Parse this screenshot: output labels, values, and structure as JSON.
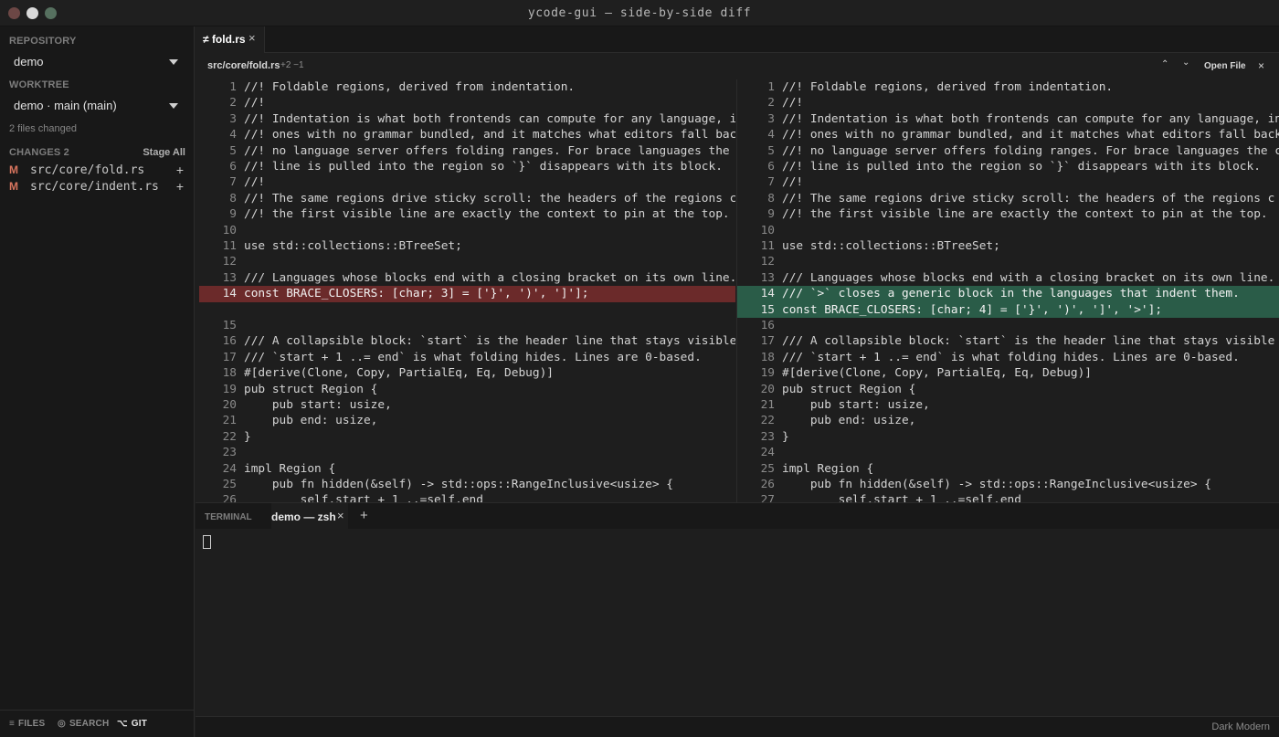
{
  "window": {
    "title": "ycode-gui — side-by-side diff"
  },
  "sidebar": {
    "repository_label": "REPOSITORY",
    "repository_value": "demo",
    "worktree_label": "WORKTREE",
    "worktree_value": "demo · main (main)",
    "files_changed": "2 files changed",
    "changes_label": "CHANGES 2",
    "stage_all": "Stage All",
    "changes": [
      {
        "status": "M",
        "path": "src/core/fold.rs",
        "action": "+"
      },
      {
        "status": "M",
        "path": "src/core/indent.rs",
        "action": "+"
      }
    ],
    "footer": [
      {
        "icon": "≡",
        "icon_name": "files-icon",
        "label": "FILES"
      },
      {
        "icon": "◎",
        "icon_name": "search-icon",
        "label": "SEARCH"
      },
      {
        "icon": "⌥",
        "icon_name": "git-branch-icon",
        "label": "GIT"
      }
    ]
  },
  "editor": {
    "tab": {
      "icon": "≠",
      "label": "fold.rs",
      "close": "×"
    },
    "diff_header": {
      "path": "src/core/fold.rs",
      "stats": "+2 −1",
      "prev": "⌃",
      "next": "⌄",
      "open_file": "Open File",
      "close": "×"
    },
    "left_lines": [
      {
        "n": "1",
        "t": "//! Foldable regions, derived from indentation.",
        "k": ""
      },
      {
        "n": "2",
        "t": "//!",
        "k": ""
      },
      {
        "n": "3",
        "t": "//! Indentation is what both frontends can compute for any language, in",
        "k": ""
      },
      {
        "n": "4",
        "t": "//! ones with no grammar bundled, and it matches what editors fall back",
        "k": ""
      },
      {
        "n": "5",
        "t": "//! no language server offers folding ranges. For brace languages the c",
        "k": ""
      },
      {
        "n": "6",
        "t": "//! line is pulled into the region so `}` disappears with its block.",
        "k": ""
      },
      {
        "n": "7",
        "t": "//!",
        "k": ""
      },
      {
        "n": "8",
        "t": "//! The same regions drive sticky scroll: the headers of the regions c",
        "k": ""
      },
      {
        "n": "9",
        "t": "//! the first visible line are exactly the context to pin at the top.",
        "k": ""
      },
      {
        "n": "10",
        "t": "",
        "k": ""
      },
      {
        "n": "11",
        "t": "use std::collections::BTreeSet;",
        "k": ""
      },
      {
        "n": "12",
        "t": "",
        "k": ""
      },
      {
        "n": "13",
        "t": "/// Languages whose blocks end with a closing bracket on its own line.",
        "k": ""
      },
      {
        "n": "14",
        "t": "const BRACE_CLOSERS: [char; 3] = ['}', ')', ']'];",
        "k": "del"
      },
      {
        "n": "",
        "t": "",
        "k": "filler"
      },
      {
        "n": "15",
        "t": "",
        "k": ""
      },
      {
        "n": "16",
        "t": "/// A collapsible block: `start` is the header line that stays visible",
        "k": ""
      },
      {
        "n": "17",
        "t": "/// `start + 1 ..= end` is what folding hides. Lines are 0-based.",
        "k": ""
      },
      {
        "n": "18",
        "t": "#[derive(Clone, Copy, PartialEq, Eq, Debug)]",
        "k": ""
      },
      {
        "n": "19",
        "t": "pub struct Region {",
        "k": ""
      },
      {
        "n": "20",
        "t": "    pub start: usize,",
        "k": ""
      },
      {
        "n": "21",
        "t": "    pub end: usize,",
        "k": ""
      },
      {
        "n": "22",
        "t": "}",
        "k": ""
      },
      {
        "n": "23",
        "t": "",
        "k": ""
      },
      {
        "n": "24",
        "t": "impl Region {",
        "k": ""
      },
      {
        "n": "25",
        "t": "    pub fn hidden(&self) -> std::ops::RangeInclusive<usize> {",
        "k": ""
      },
      {
        "n": "26",
        "t": "        self.start + 1 ..=self.end",
        "k": ""
      }
    ],
    "right_lines": [
      {
        "n": "1",
        "t": "//! Foldable regions, derived from indentation.",
        "k": ""
      },
      {
        "n": "2",
        "t": "//!",
        "k": ""
      },
      {
        "n": "3",
        "t": "//! Indentation is what both frontends can compute for any language, in",
        "k": ""
      },
      {
        "n": "4",
        "t": "//! ones with no grammar bundled, and it matches what editors fall back",
        "k": ""
      },
      {
        "n": "5",
        "t": "//! no language server offers folding ranges. For brace languages the c",
        "k": ""
      },
      {
        "n": "6",
        "t": "//! line is pulled into the region so `}` disappears with its block.",
        "k": ""
      },
      {
        "n": "7",
        "t": "//!",
        "k": ""
      },
      {
        "n": "8",
        "t": "//! The same regions drive sticky scroll: the headers of the regions c",
        "k": ""
      },
      {
        "n": "9",
        "t": "//! the first visible line are exactly the context to pin at the top.",
        "k": ""
      },
      {
        "n": "10",
        "t": "",
        "k": ""
      },
      {
        "n": "11",
        "t": "use std::collections::BTreeSet;",
        "k": ""
      },
      {
        "n": "12",
        "t": "",
        "k": ""
      },
      {
        "n": "13",
        "t": "/// Languages whose blocks end with a closing bracket on its own line.",
        "k": ""
      },
      {
        "n": "14",
        "t": "/// `>` closes a generic block in the languages that indent them.",
        "k": "add"
      },
      {
        "n": "15",
        "t": "const BRACE_CLOSERS: [char; 4] = ['}', ')', ']', '>'];",
        "k": "add"
      },
      {
        "n": "16",
        "t": "",
        "k": ""
      },
      {
        "n": "17",
        "t": "/// A collapsible block: `start` is the header line that stays visible",
        "k": ""
      },
      {
        "n": "18",
        "t": "/// `start + 1 ..= end` is what folding hides. Lines are 0-based.",
        "k": ""
      },
      {
        "n": "19",
        "t": "#[derive(Clone, Copy, PartialEq, Eq, Debug)]",
        "k": ""
      },
      {
        "n": "20",
        "t": "pub struct Region {",
        "k": ""
      },
      {
        "n": "21",
        "t": "    pub start: usize,",
        "k": ""
      },
      {
        "n": "22",
        "t": "    pub end: usize,",
        "k": ""
      },
      {
        "n": "23",
        "t": "}",
        "k": ""
      },
      {
        "n": "24",
        "t": "",
        "k": ""
      },
      {
        "n": "25",
        "t": "impl Region {",
        "k": ""
      },
      {
        "n": "26",
        "t": "    pub fn hidden(&self) -> std::ops::RangeInclusive<usize> {",
        "k": ""
      },
      {
        "n": "27",
        "t": "        self.start + 1 ..=self.end",
        "k": ""
      }
    ]
  },
  "terminal": {
    "label": "TERMINAL",
    "tab_label": "demo — zsh",
    "tab_close": "×",
    "add": "+"
  },
  "statusbar": {
    "theme": "Dark Modern"
  },
  "colors": {
    "deleted_line": "#6b2a2a",
    "added_line": "#2a5c48",
    "modified_status": "#d7745e"
  }
}
